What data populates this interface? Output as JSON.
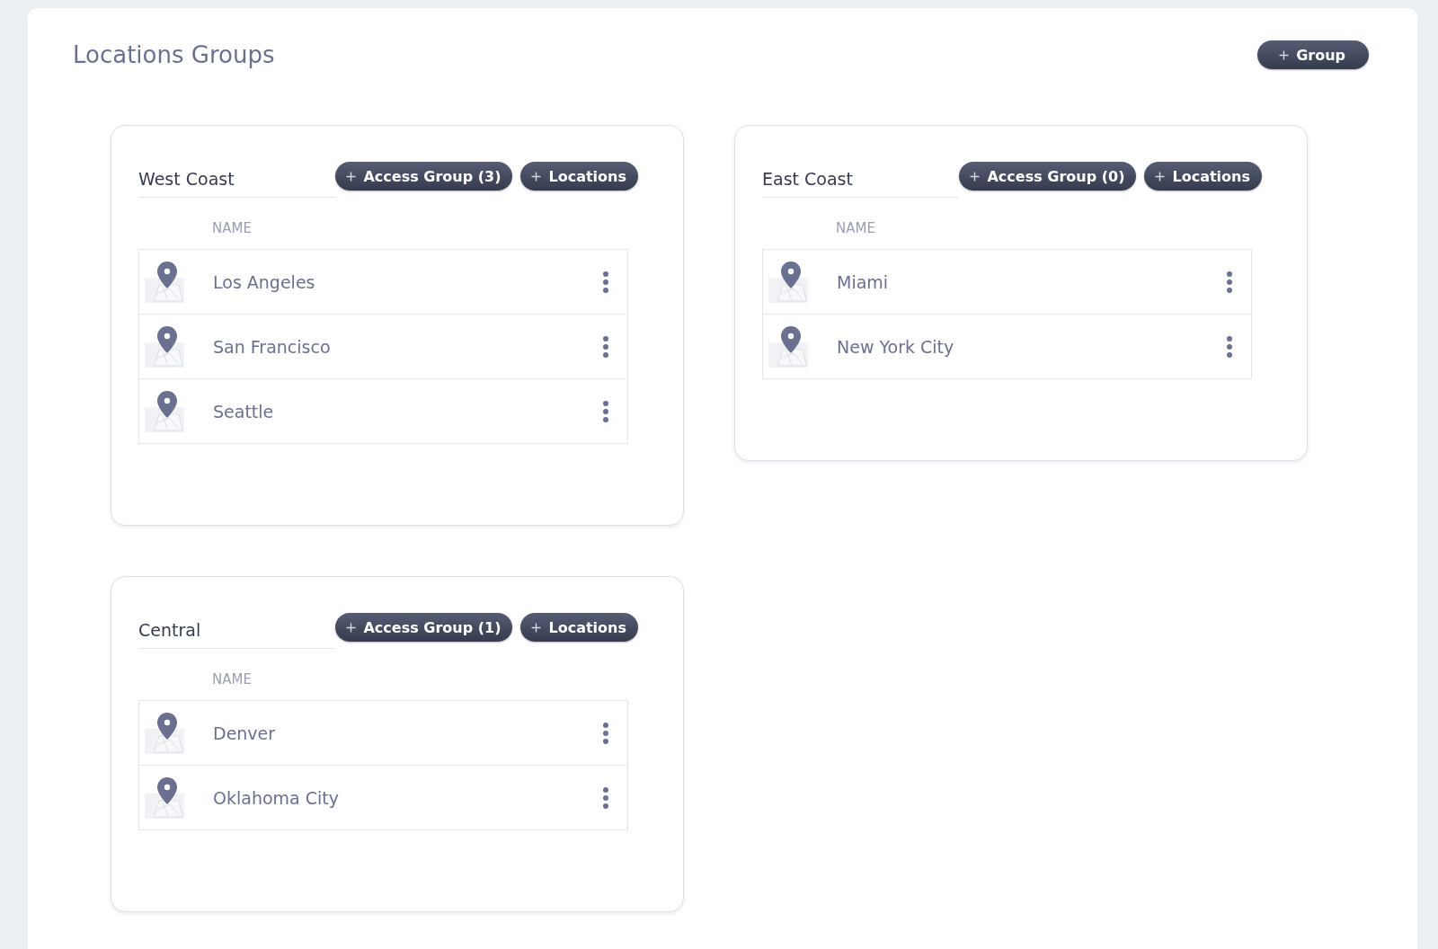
{
  "page": {
    "title": "Locations Groups",
    "add_button": "Group"
  },
  "groups": [
    {
      "name": "West Coast",
      "access_button": "Access Group (3)",
      "locations_button": "Locations",
      "column_header": "NAME",
      "locations": [
        {
          "name": "Los Angeles"
        },
        {
          "name": "San Francisco"
        },
        {
          "name": "Seattle"
        }
      ]
    },
    {
      "name": "East Coast",
      "access_button": "Access Group (0)",
      "locations_button": "Locations",
      "column_header": "NAME",
      "locations": [
        {
          "name": "Miami"
        },
        {
          "name": "New York City"
        }
      ]
    },
    {
      "name": "Central",
      "access_button": "Access Group (1)",
      "locations_button": "Locations",
      "column_header": "NAME",
      "locations": [
        {
          "name": "Denver"
        },
        {
          "name": "Oklahoma City"
        }
      ]
    }
  ]
}
